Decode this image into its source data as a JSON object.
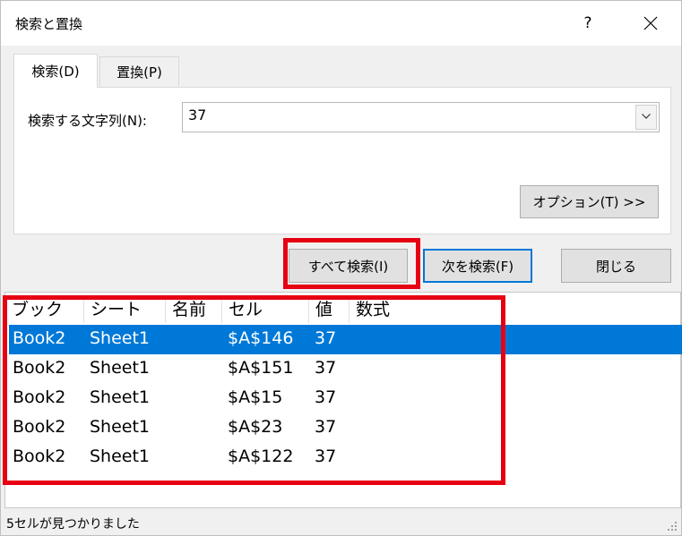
{
  "dialog": {
    "title": "検索と置換",
    "help_label": "?"
  },
  "tabs": [
    {
      "label": "検索(D)",
      "active": true
    },
    {
      "label": "置換(P)",
      "active": false
    }
  ],
  "search": {
    "label": "検索する文字列(N):",
    "value": "37"
  },
  "buttons": {
    "options": "オプション(T) >>",
    "find_all": "すべて検索(I)",
    "find_next": "次を検索(F)",
    "close": "閉じる"
  },
  "results": {
    "columns": [
      "ブック",
      "シート",
      "名前",
      "セル",
      "値",
      "数式"
    ],
    "rows": [
      {
        "book": "Book2",
        "sheet": "Sheet1",
        "name": "",
        "cell": "$A$146",
        "value": "37",
        "formula": "",
        "selected": true
      },
      {
        "book": "Book2",
        "sheet": "Sheet1",
        "name": "",
        "cell": "$A$151",
        "value": "37",
        "formula": "",
        "selected": false
      },
      {
        "book": "Book2",
        "sheet": "Sheet1",
        "name": "",
        "cell": "$A$15",
        "value": "37",
        "formula": "",
        "selected": false
      },
      {
        "book": "Book2",
        "sheet": "Sheet1",
        "name": "",
        "cell": "$A$23",
        "value": "37",
        "formula": "",
        "selected": false
      },
      {
        "book": "Book2",
        "sheet": "Sheet1",
        "name": "",
        "cell": "$A$122",
        "value": "37",
        "formula": "",
        "selected": false
      }
    ]
  },
  "status": {
    "text": "5セルが見つかりました"
  },
  "colors": {
    "selection": "#0078d7",
    "highlight": "#e60012"
  }
}
